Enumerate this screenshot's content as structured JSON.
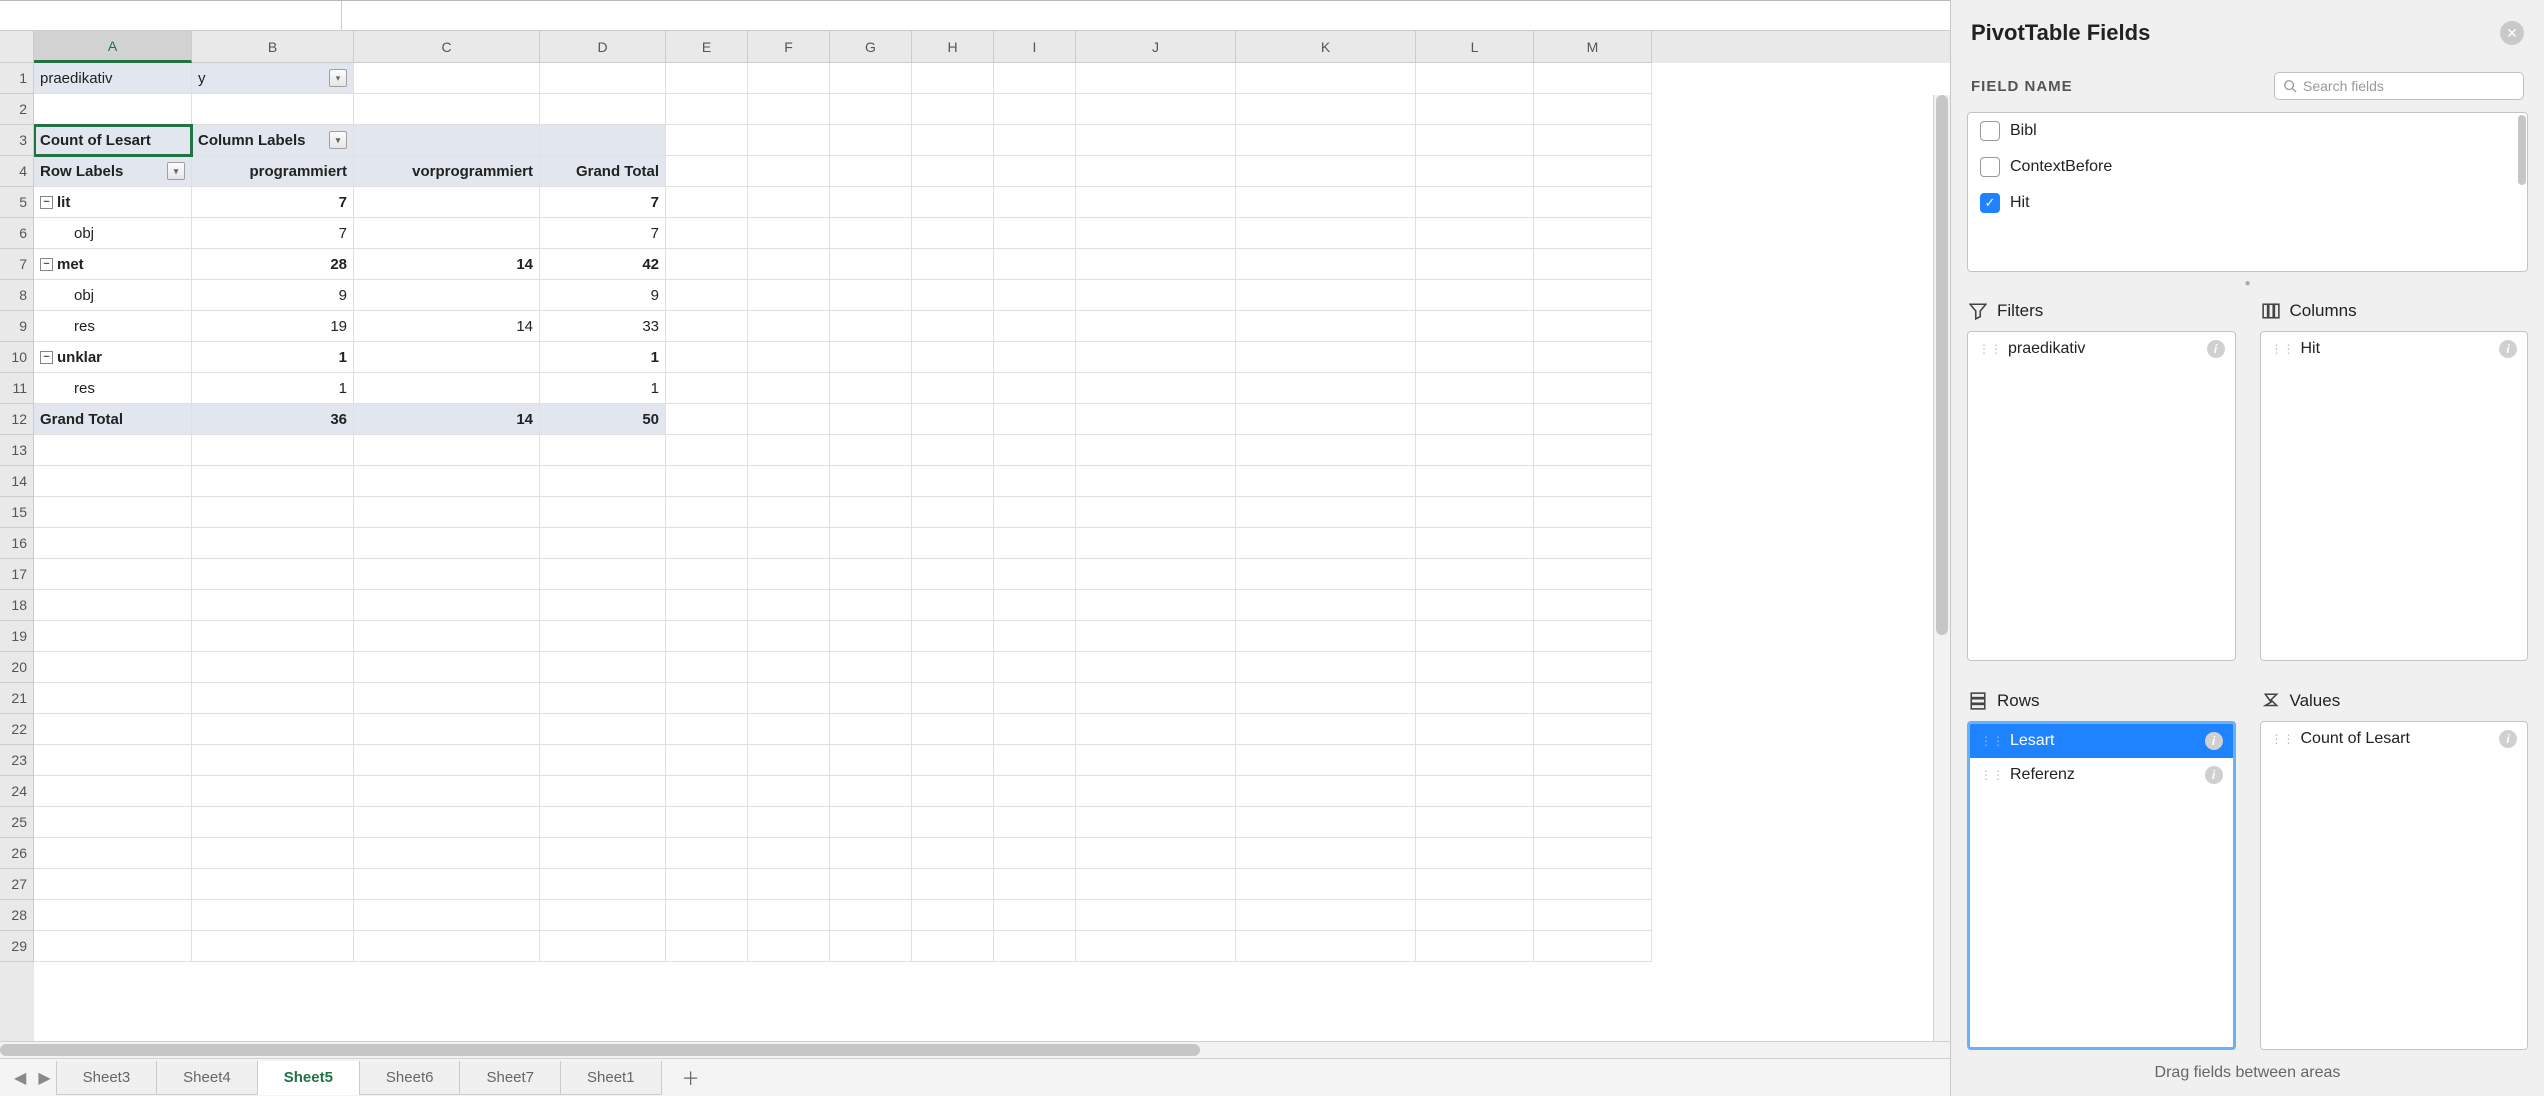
{
  "columns": {
    "A": 158,
    "B": 162,
    "C": 186,
    "D": 126,
    "E": 82,
    "F": 82,
    "G": 82,
    "H": 82,
    "I": 82,
    "J": 160,
    "K": 180,
    "L": 118,
    "M": 118
  },
  "active_cell": {
    "col": "A",
    "row": 3
  },
  "rows_visible": 29,
  "pivot": {
    "filter_label": "praedikativ",
    "filter_value": "y",
    "values_label": "Count of Lesart",
    "cols_label": "Column Labels",
    "rows_label": "Row Labels",
    "col_headers": [
      "programmiert",
      "vorprogrammiert",
      "Grand Total"
    ],
    "rows": [
      {
        "label": "lit",
        "type": "group",
        "vals": [
          7,
          "",
          7
        ]
      },
      {
        "label": "obj",
        "type": "sub",
        "vals": [
          7,
          "",
          7
        ]
      },
      {
        "label": "met",
        "type": "group",
        "vals": [
          28,
          14,
          42
        ]
      },
      {
        "label": "obj",
        "type": "sub",
        "vals": [
          9,
          "",
          9
        ]
      },
      {
        "label": "res",
        "type": "sub",
        "vals": [
          19,
          14,
          33
        ]
      },
      {
        "label": "unklar",
        "type": "group",
        "vals": [
          1,
          "",
          1
        ]
      },
      {
        "label": "res",
        "type": "sub",
        "vals": [
          1,
          "",
          1
        ]
      }
    ],
    "grand_total_label": "Grand Total",
    "grand_total": [
      36,
      14,
      50
    ]
  },
  "sheets": {
    "tabs": [
      "Sheet3",
      "Sheet4",
      "Sheet5",
      "Sheet6",
      "Sheet7",
      "Sheet1"
    ],
    "active": "Sheet5"
  },
  "panel": {
    "title": "PivotTable Fields",
    "field_name_label": "FIELD NAME",
    "search_placeholder": "Search fields",
    "fields": [
      {
        "name": "Bibl",
        "checked": false
      },
      {
        "name": "ContextBefore",
        "checked": false
      },
      {
        "name": "Hit",
        "checked": true
      }
    ],
    "areas": {
      "filters": {
        "label": "Filters",
        "items": [
          {
            "name": "praedikativ"
          }
        ]
      },
      "columns": {
        "label": "Columns",
        "items": [
          {
            "name": "Hit"
          }
        ]
      },
      "rows": {
        "label": "Rows",
        "items": [
          {
            "name": "Lesart",
            "selected": true
          },
          {
            "name": "Referenz"
          }
        ]
      },
      "values": {
        "label": "Values",
        "items": [
          {
            "name": "Count of Lesart"
          }
        ]
      }
    },
    "footer_hint": "Drag fields between areas"
  }
}
